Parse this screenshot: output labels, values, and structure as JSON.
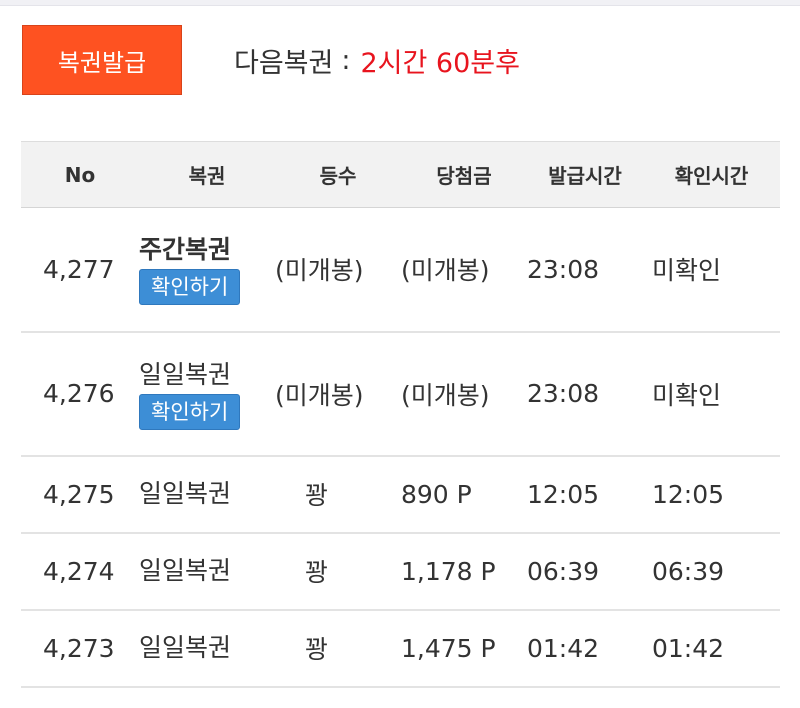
{
  "header": {
    "issue_button": "복권발급",
    "next_label": "다음복권",
    "next_separator": ":",
    "next_value": "2시간 60분후"
  },
  "columns": [
    "No",
    "복권",
    "등수",
    "당첨금",
    "발급시간",
    "확인시간"
  ],
  "rows": [
    {
      "no": "4,277",
      "ticket": "주간복권",
      "button": "확인하기",
      "prize": "(미개봉)",
      "amount": "(미개봉)",
      "issued": "23:08",
      "checked": "미확인"
    },
    {
      "no": "4,276",
      "ticket": "일일복권",
      "button": "확인하기",
      "prize": "(미개봉)",
      "amount": "(미개봉)",
      "issued": "23:08",
      "checked": "미확인"
    },
    {
      "no": "4,275",
      "ticket": "일일복권",
      "prize": "꽝",
      "amount": "890 P",
      "issued": "12:05",
      "checked": "12:05"
    },
    {
      "no": "4,274",
      "ticket": "일일복권",
      "prize": "꽝",
      "amount": "1,178 P",
      "issued": "06:39",
      "checked": "06:39"
    },
    {
      "no": "4,273",
      "ticket": "일일복권",
      "prize": "꽝",
      "amount": "1,475 P",
      "issued": "01:42",
      "checked": "01:42"
    }
  ],
  "colors": {
    "issue_button": "#fe5221",
    "next_value": "#e8141e",
    "confirm_button": "#3d8ed6",
    "unconfirmed": "#eb9d1a"
  }
}
